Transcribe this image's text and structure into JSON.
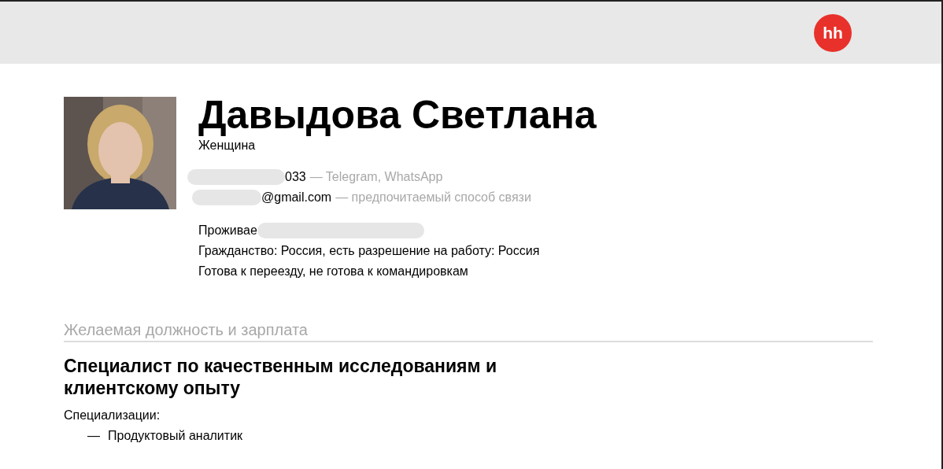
{
  "header": {
    "logo": "hh"
  },
  "profile": {
    "name": "Давыдова Светлана",
    "gender": "Женщина"
  },
  "contacts": [
    {
      "value": "033",
      "note": "— Telegram, WhatsApp",
      "redacted": true
    },
    {
      "value": "@gmail.com",
      "note": "— предпочитаемый способ связи",
      "redacted": true
    }
  ],
  "details": [
    {
      "text": "Проживае",
      "redacted": true
    },
    {
      "text": "Гражданство: Россия, есть разрешение на работу: Россия",
      "redacted": false
    },
    {
      "text": "Готова к переезду, не готова к командировкам",
      "redacted": false
    }
  ],
  "section": {
    "title": "Желаемая должность и зарплата",
    "position": "Специалист по качественным исследованиям и клиентскому опыту",
    "specializations_label": "Специализации:",
    "specializations": [
      {
        "marker": "—",
        "text": "Продуктовый аналитик"
      }
    ]
  }
}
